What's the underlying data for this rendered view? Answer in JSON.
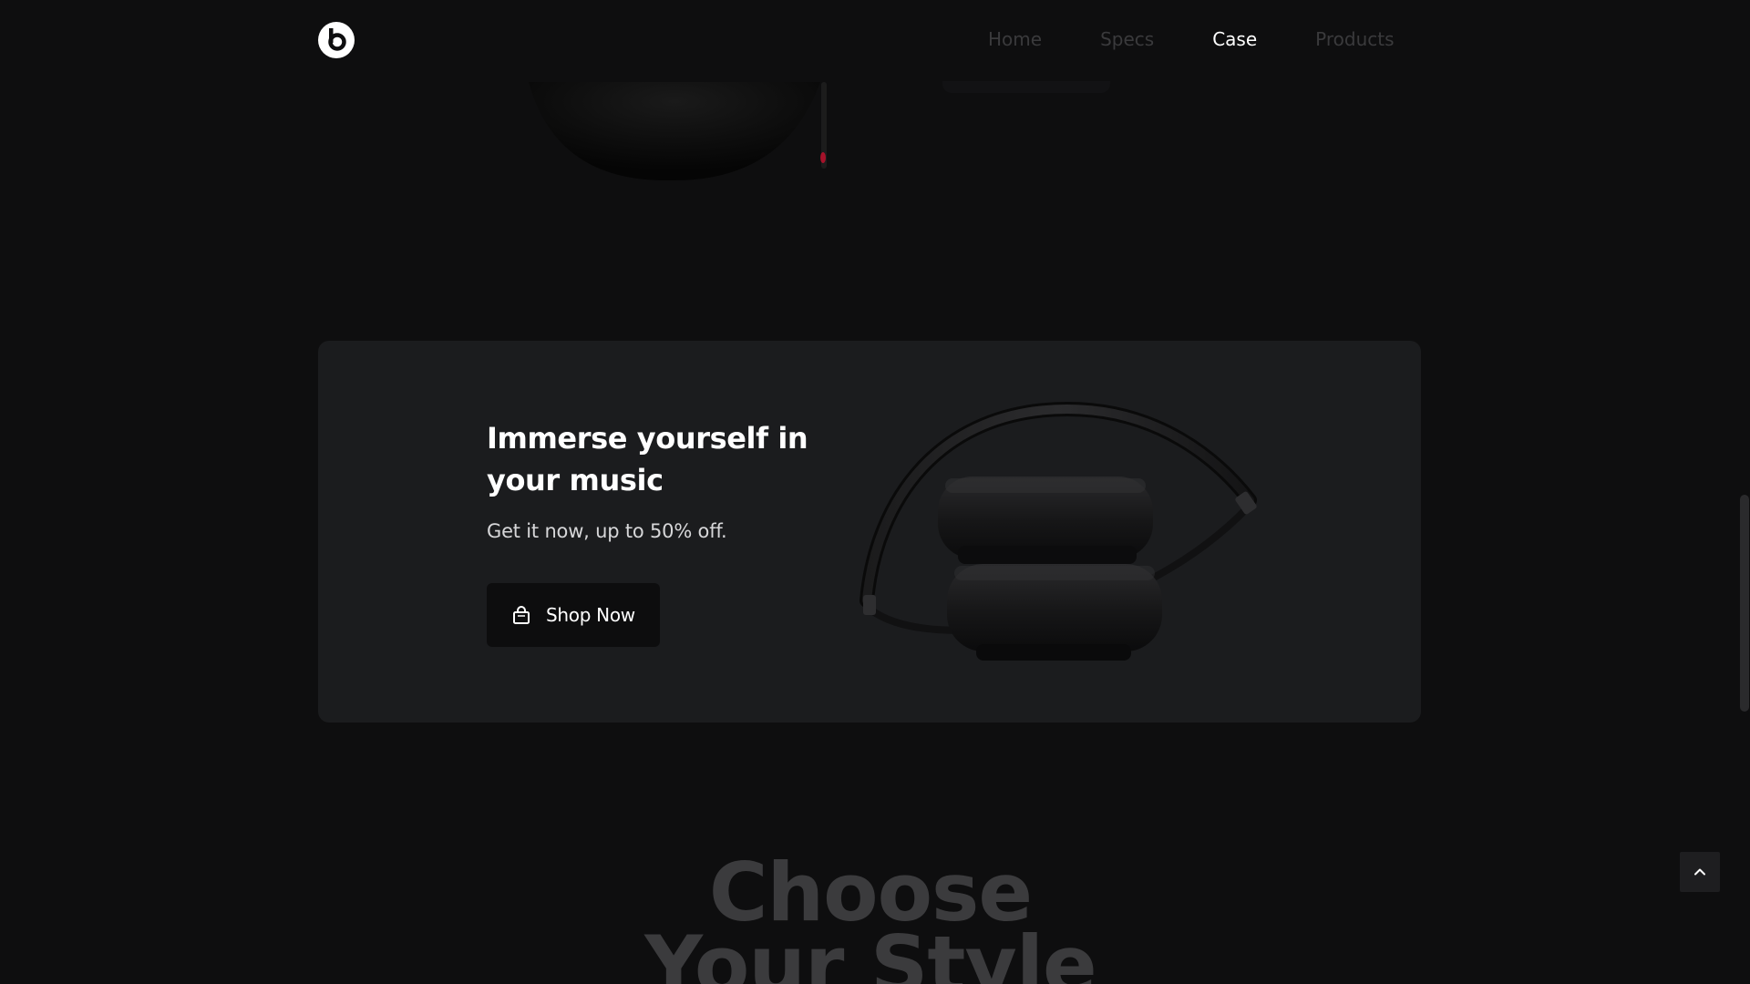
{
  "header": {
    "logo_icon": "beats-logo-icon",
    "nav": [
      {
        "label": "Home",
        "active": false
      },
      {
        "label": "Specs",
        "active": false
      },
      {
        "label": "Case",
        "active": true
      },
      {
        "label": "Products",
        "active": false
      }
    ]
  },
  "promo": {
    "title": "Immerse yourself in your music",
    "subtitle": "Get it now, up to 50% off.",
    "button_label": "Shop Now",
    "button_icon": "shopping-bag-icon",
    "image": "folded-headphones-image"
  },
  "section": {
    "heading_line1": "Choose",
    "heading_line2": "Your Style"
  },
  "back_to_top_icon": "chevron-up-icon",
  "colors": {
    "background": "#0e0e0f",
    "card": "#1b1c1e",
    "nav_inactive": "#3a3a3c",
    "nav_active": "#ffffff",
    "heading_muted": "#3b3b3d"
  }
}
